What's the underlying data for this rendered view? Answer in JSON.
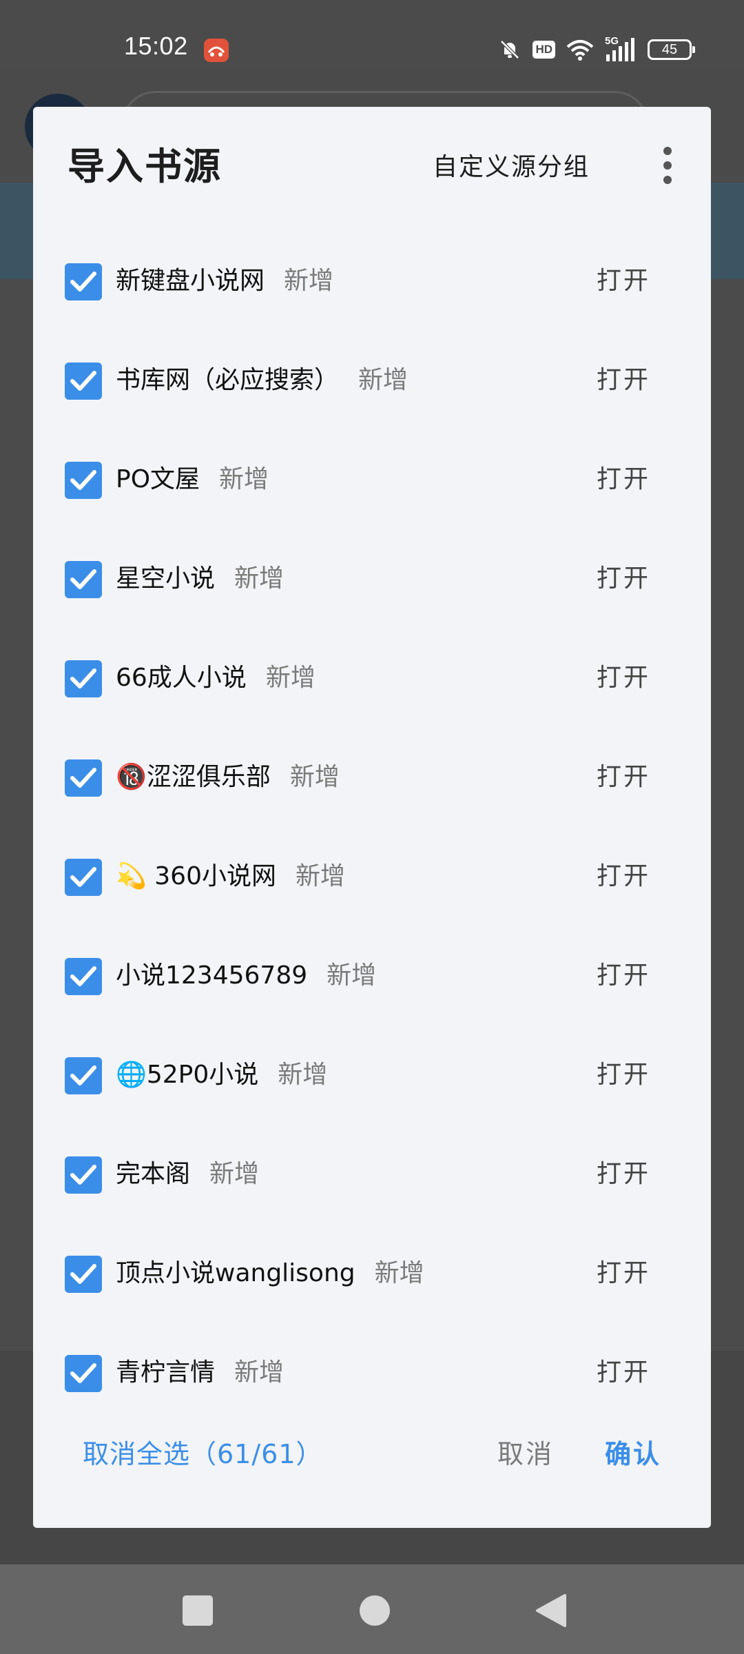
{
  "status_bar": {
    "time": "15:02",
    "hd_label": "HD",
    "network_label": "5G",
    "battery_level": "45",
    "icons": [
      "notification-app-icon",
      "mute-bell-icon",
      "hd-icon",
      "wifi-icon",
      "signal-icon",
      "battery-icon"
    ]
  },
  "dialog": {
    "title": "导入书源",
    "group_button": "自定义源分组",
    "more_icon": "more-vertical-icon",
    "items": [
      {
        "name": "新键盘小说网",
        "tag": "新增",
        "action": "打开",
        "checked": true
      },
      {
        "name": "书库网（必应搜索）",
        "tag": "新增",
        "action": "打开",
        "checked": true
      },
      {
        "name": "PO文屋",
        "tag": "新增",
        "action": "打开",
        "checked": true
      },
      {
        "name": "星空小说",
        "tag": "新增",
        "action": "打开",
        "checked": true
      },
      {
        "name": "66成人小说",
        "tag": "新增",
        "action": "打开",
        "checked": true
      },
      {
        "name": "🔞涩涩俱乐部",
        "tag": "新增",
        "action": "打开",
        "checked": true
      },
      {
        "name": "💫 360小说网",
        "tag": "新增",
        "action": "打开",
        "checked": true
      },
      {
        "name": "小说123456789",
        "tag": "新增",
        "action": "打开",
        "checked": true
      },
      {
        "name": "🌐52P0小说",
        "tag": "新增",
        "action": "打开",
        "checked": true
      },
      {
        "name": "完本阁",
        "tag": "新增",
        "action": "打开",
        "checked": true
      },
      {
        "name": "顶点小说wanglisong",
        "tag": "新增",
        "action": "打开",
        "checked": true
      },
      {
        "name": "青柠言情",
        "tag": "新增",
        "action": "打开",
        "checked": true
      }
    ],
    "footer": {
      "toggle_select": "取消全选（61/61）",
      "cancel": "取消",
      "confirm": "确认"
    }
  },
  "nav_bar": {
    "icons": [
      "recents-square-icon",
      "home-circle-icon",
      "back-triangle-icon"
    ]
  },
  "colors": {
    "accent": "#3b8ee8",
    "dialog_bg": "#f2f4f7",
    "tag_gray": "#7a7a7a"
  }
}
